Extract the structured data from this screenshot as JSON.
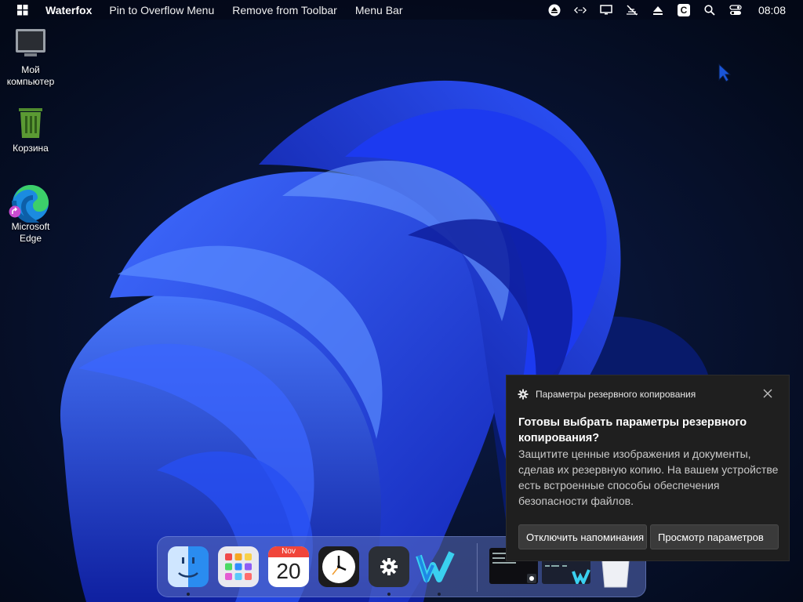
{
  "menubar": {
    "app_name": "Waterfox",
    "items": [
      "Pin to Overflow Menu",
      "Remove from Toolbar",
      "Menu Bar"
    ],
    "clock": "08:08",
    "tray_icons": [
      "eject-icon",
      "remote-code-icon",
      "display-icon",
      "network-off-icon",
      "upload-icon",
      "c-app-icon",
      "search-icon",
      "control-center-icon"
    ],
    "tray_c_letter": "C"
  },
  "desktop": {
    "icons": [
      {
        "label": "Мой компьютер",
        "icon": "computer-icon"
      },
      {
        "label": "Корзина",
        "icon": "recycle-bin-icon"
      },
      {
        "label": "Microsoft Edge",
        "icon": "edge-icon"
      }
    ]
  },
  "notification": {
    "app": "Параметры резервного копирования",
    "title": "Готовы выбрать параметры резервного копирования?",
    "body": "Защитите ценные изображения и документы, сделав их резервную копию. На вашем устройстве есть встроенные способы обеспечения безопасности файлов.",
    "dismiss_button": "Отключить напоминания",
    "view_button": "Просмотр параметров"
  },
  "dock": {
    "items": [
      "finder-icon",
      "launchpad-icon",
      "calendar-icon",
      "clock-icon",
      "settings-icon",
      "waterfox-icon"
    ],
    "calendar": {
      "month": "Nov",
      "day": "20"
    },
    "recent": [
      "terminal-window-thumbnail",
      "browser-window-thumbnail",
      "trash-icon"
    ]
  },
  "colors": {
    "wallpaper_bg": "#050d24",
    "bloom": "#1f3df0",
    "toast_bg": "#1f1f1f",
    "toast_btn": "#3a3a3a"
  }
}
